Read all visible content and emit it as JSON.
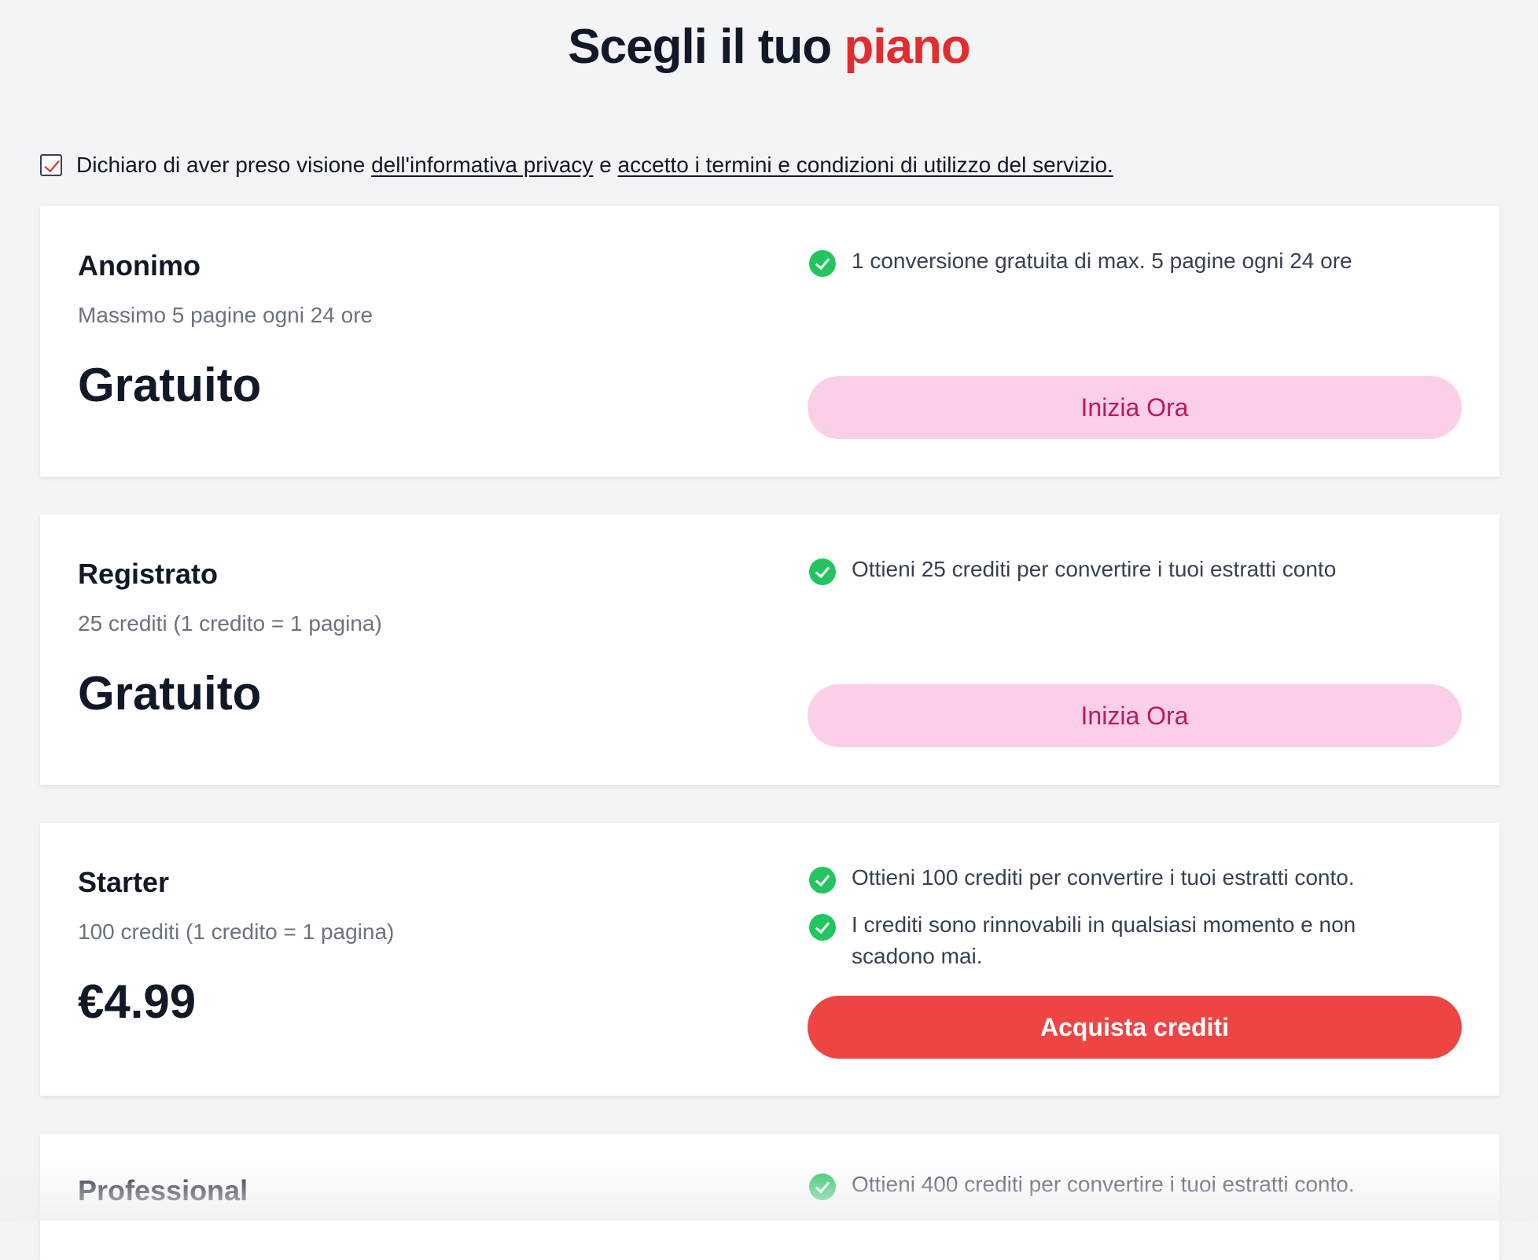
{
  "header": {
    "title_main": "Scegli il tuo",
    "title_accent": "piano",
    "accent_color": "#e32c2c"
  },
  "consent": {
    "checked": true,
    "text_before": "Dichiaro di aver preso visione",
    "privacy_link": "dell'informativa privacy",
    "text_middle": "e",
    "terms_link": "accetto i termini e condizioni di utilizzo del servizio."
  },
  "plans": [
    {
      "name": "Anonimo",
      "subtitle": "Massimo 5 pagine ogni 24 ore",
      "price": "Gratuito",
      "features": [
        "1 conversione gratuita di max. 5 pagine ogni 24 ore"
      ],
      "cta": "Inizia Ora"
    },
    {
      "name": "Registrato",
      "subtitle": "25 crediti (1 credito = 1 pagina)",
      "price": "Gratuito",
      "features": [
        "Ottieni 25 crediti per convertire i tuoi estratti conto"
      ],
      "cta": "Inizia Ora"
    },
    {
      "name": "Starter",
      "subtitle": "100 crediti (1 credito = 1 pagina)",
      "price": "€4.99",
      "features": [
        "Ottieni 100 crediti per convertire i tuoi estratti conto.",
        "I crediti sono rinnovabili in qualsiasi momento e non scadono mai."
      ],
      "cta": "Acquista crediti"
    },
    {
      "name": "Professional",
      "features": [
        "Ottieni 400 crediti per convertire i tuoi estratti conto."
      ]
    }
  ],
  "colors": {
    "background": "#f3f4f6",
    "check_green": "#22c55e",
    "cta_light_bg": "#fbcfe8",
    "cta_light_text": "#be185d",
    "cta_strong_bg": "#ef4444"
  },
  "icons": {
    "feature": "check-circle-icon",
    "consent": "checkbox-checked-icon"
  }
}
